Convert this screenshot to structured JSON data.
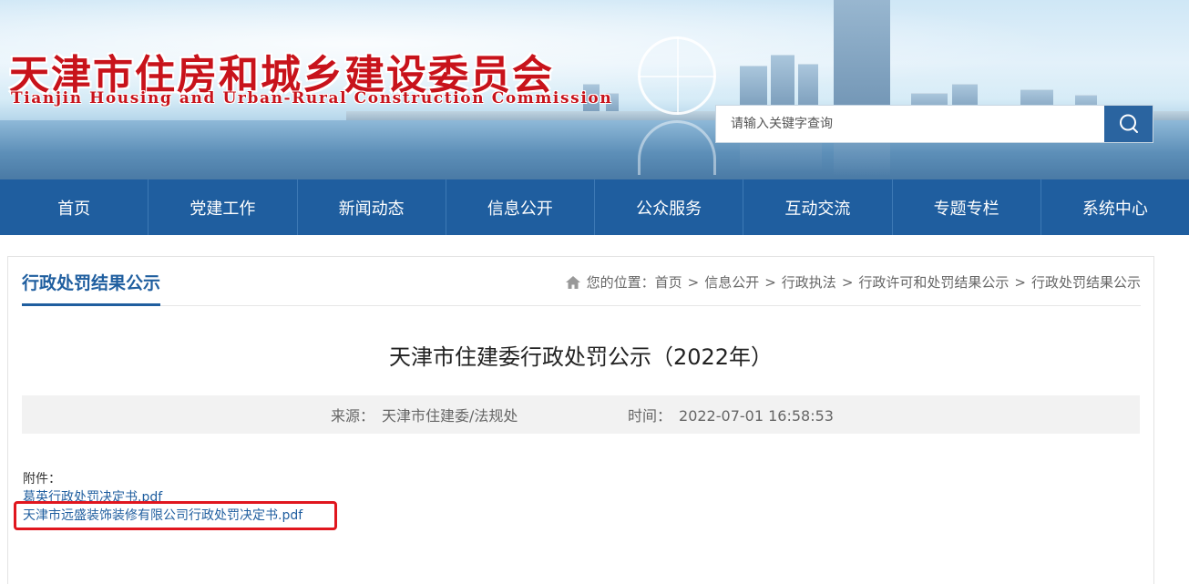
{
  "header": {
    "title_cn": "天津市住房和城乡建设委员会",
    "title_en": "Tianjin Housing and Urban-Rural Construction Commission",
    "search_placeholder": "请输入关键字查询",
    "search_icon": "search-icon"
  },
  "nav": {
    "items": [
      {
        "label": "首页"
      },
      {
        "label": "党建工作"
      },
      {
        "label": "新闻动态"
      },
      {
        "label": "信息公开"
      },
      {
        "label": "公众服务"
      },
      {
        "label": "互动交流"
      },
      {
        "label": "专题专栏"
      },
      {
        "label": "系统中心"
      }
    ]
  },
  "section": {
    "title": "行政处罚结果公示",
    "breadcrumb_prefix": "您的位置：",
    "breadcrumb": [
      "首页",
      "信息公开",
      "行政执法",
      "行政许可和处罚结果公示",
      "行政处罚结果公示"
    ],
    "breadcrumb_sep": ">"
  },
  "article": {
    "title": "天津市住建委行政处罚公示（2022年）",
    "source_label": "来源：",
    "source_value": "天津市住建委/法规处",
    "time_label": "时间：",
    "time_value": "2022-07-01 16:58:53",
    "attachments_label": "附件：",
    "attachments": [
      {
        "name": "葛英行政处罚决定书.pdf"
      },
      {
        "name": "天津市远盛装饰装修有限公司行政处罚决定书.pdf"
      }
    ]
  },
  "colors": {
    "brand_blue": "#1f5e9f",
    "title_red": "#c8131b",
    "highlight_red": "#e0161e"
  }
}
